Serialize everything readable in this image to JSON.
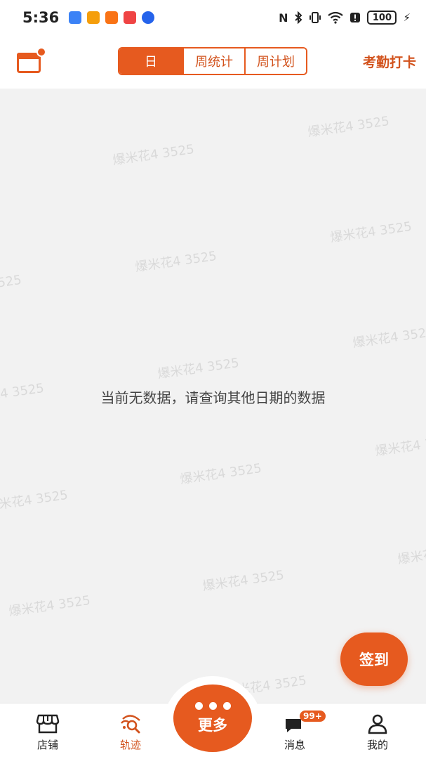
{
  "status_bar": {
    "time": "5:36",
    "battery": "100",
    "status_icons": [
      "nfc-icon",
      "bluetooth-icon",
      "vibrate-icon",
      "wifi-icon",
      "alert-icon"
    ]
  },
  "header": {
    "tabs": [
      {
        "label": "日",
        "active": true
      },
      {
        "label": "周统计",
        "active": false
      },
      {
        "label": "周计划",
        "active": false
      }
    ],
    "attendance_label": "考勤打卡"
  },
  "main": {
    "empty_message": "当前无数据，请查询其他日期的数据",
    "watermark": "爆米花4 3525"
  },
  "checkin_button": "签到",
  "bottom_nav": {
    "shop": "店铺",
    "track": "轨迹",
    "more": "更多",
    "messages": "消息",
    "messages_badge": "99+",
    "mine": "我的"
  },
  "colors": {
    "accent": "#e65a1f",
    "background": "#f2f2f2"
  }
}
